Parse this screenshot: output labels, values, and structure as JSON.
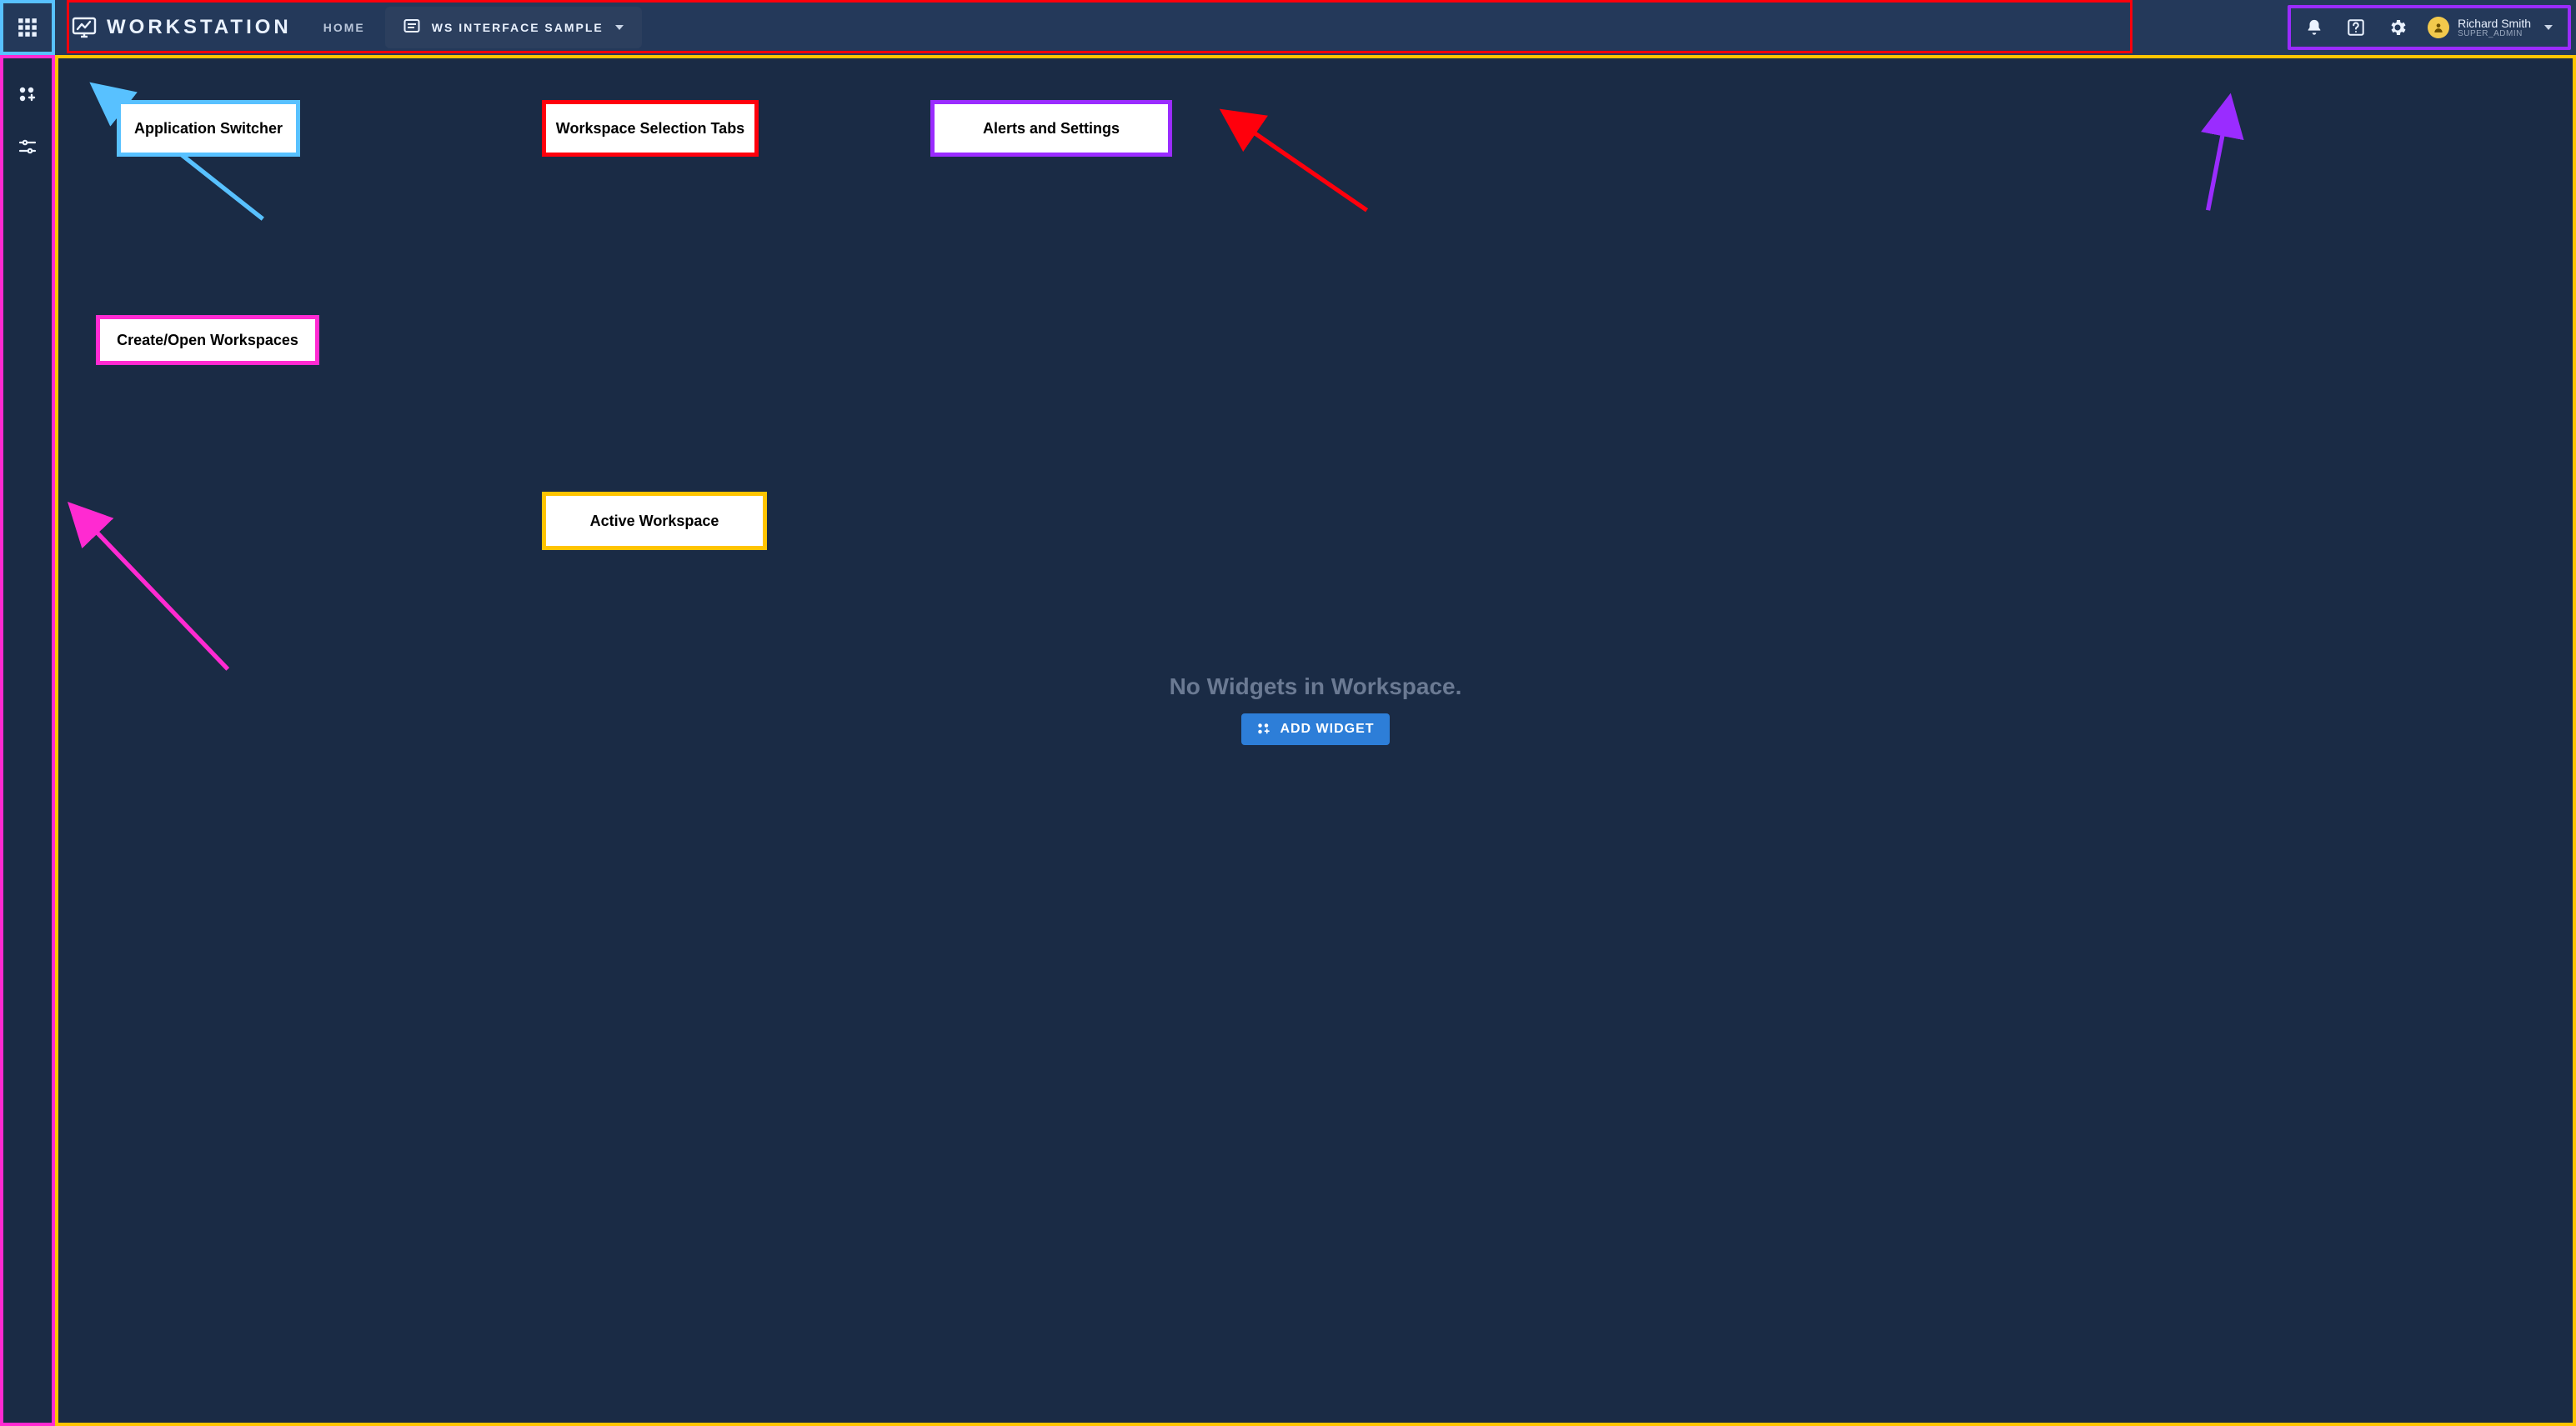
{
  "header": {
    "app_title": "WORKSTATION",
    "home_label": "HOME",
    "workspace_tab_label": "WS INTERFACE SAMPLE"
  },
  "user": {
    "name": "Richard Smith",
    "role": "SUPER_ADMIN"
  },
  "main": {
    "empty_message": "No Widgets in Workspace.",
    "add_widget_label": "ADD WIDGET"
  },
  "annotations": {
    "app_switcher": "Application Switcher",
    "ws_tabs": "Workspace Selection Tabs",
    "alerts_settings": "Alerts and Settings",
    "sidebar": "Create/Open Workspaces",
    "active_workspace": "Active Workspace"
  }
}
